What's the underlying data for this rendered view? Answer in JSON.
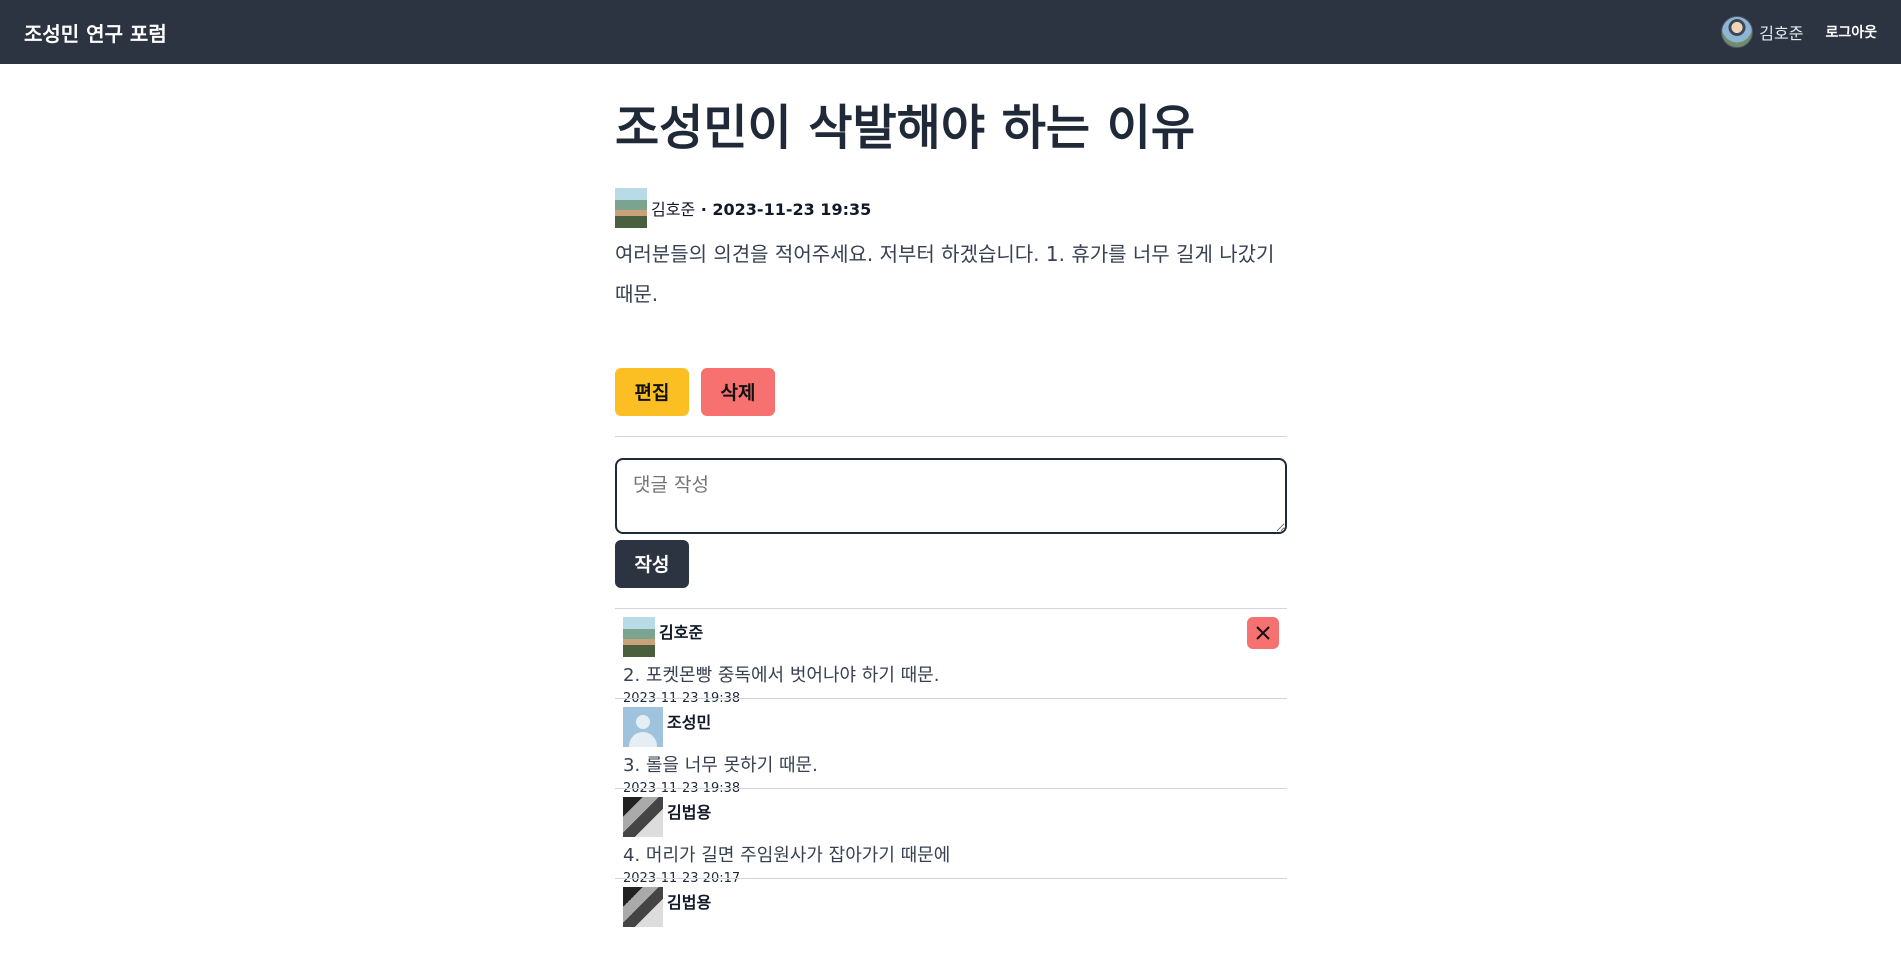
{
  "navbar": {
    "brand": "조성민 연구 포럼",
    "user_name": "김호준",
    "logout_label": "로그아웃"
  },
  "post": {
    "title": "조성민이 삭발해야 하는 이유",
    "author": "김호준",
    "separator": " · ",
    "date": "2023-11-23 19:35",
    "body": "여러분들의 의견을 적어주세요. 저부터 하겠습니다. 1. 휴가를 너무 길게 나갔기 때문.",
    "edit_label": "편집",
    "delete_label": "삭제"
  },
  "comment_form": {
    "placeholder": "댓글 작성",
    "submit_label": "작성"
  },
  "comments": [
    {
      "author": "김호준",
      "text": "2. 포켓몬빵 중독에서 벗어나야 하기 때문.",
      "date": "2023-11-23 19:38"
    },
    {
      "author": "조성민",
      "text": "3. 롤을 너무 못하기 때문.",
      "date": "2023-11-23 19:38"
    },
    {
      "author": "김법용",
      "text": "4. 머리가 길면 주임원사가 잡아가기 때문에",
      "date": "2023-11-23 20:17"
    },
    {
      "author": "김법용"
    }
  ],
  "icons": {
    "comment_delete": "close-icon"
  },
  "colors": {
    "navbar_bg": "#2d3441",
    "edit_button": "#fbbf24",
    "delete_button": "#f87171"
  }
}
